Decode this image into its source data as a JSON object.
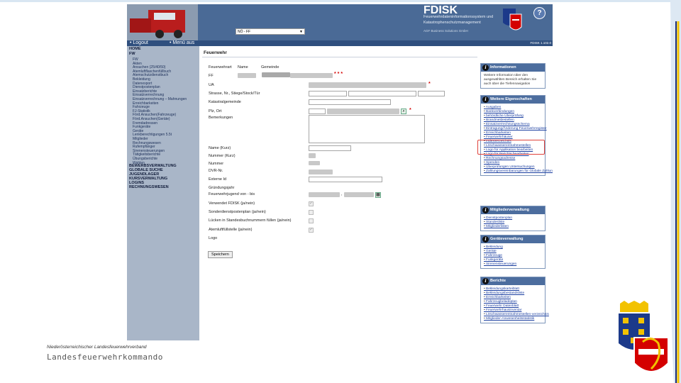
{
  "app": {
    "brand": "FDISK",
    "subtitle": "Feuerwehrdateninformationssystem und Katastrophenschutzmanagement",
    "company": "AGF Business Solutions GmbH",
    "version": "FDISK 1.102.0",
    "ff_select": "NÖ - FF"
  },
  "nav": {
    "logout": "• Logout",
    "menu": "• Menü aus"
  },
  "sidebar": {
    "home": "HOME",
    "fw": "FW",
    "fw_items": [
      "FW",
      "Akten",
      "Ansuchen (25/40/50)",
      "Atemluftflaschenfüllbuch",
      "Atemschutzdienstbuch",
      "Bekleidung",
      "Datenexport",
      "Dienstpostenplan",
      "Einsatzberichte",
      "Einsatzverrechnung",
      "Einsatzverrechnung – Mahnungen",
      "Erreichbarkeiten",
      "Fahrzeuge",
      "FJ-Statistik",
      "Förd.Ansuchen(Fahrzeuge)",
      "Förd.Ansuchen(Geräte)",
      "Fremdadressen",
      "Funkgeräte",
      "Geräte",
      "Lenkberechtigungen 5.5t",
      "Mitglieder",
      "Rechnungswesen",
      "Rufempfänger",
      "Sirenensteuerungen",
      "Tätigkeitsberichte",
      "Übungsberichte",
      "Wahlen"
    ],
    "sections": [
      "BEWERBSVERWALTUNG",
      "GLOBALE SUCHE",
      "JUGENDLAGER",
      "KURSVERWALTUNG",
      "LOGINS",
      "RECHNUNGSWESEN"
    ]
  },
  "main": {
    "title": "Feuerwehr",
    "col_heads": [
      "Feuerwehrart",
      "Name",
      "Gemeinde"
    ],
    "labels": {
      "ff": "FF",
      "ua": "UA",
      "street": "Strasse, Nr., Stiege/Stock/Tür",
      "katastral": "Katastralgemeinde",
      "plz": "Plz, Ort",
      "notes": "Bemerkungen",
      "name_short": "Name (Kurz)",
      "number_short": "Nummer (Kurz)",
      "number": "Nummer",
      "dvr": "DVR-Nr.",
      "external_id": "Externe Id",
      "founding_year": "Gründungsjahr",
      "youth": "Feuerwehrjugend von - bis",
      "uses_fdisk": "Verwendet FDISK (ja/nein)",
      "special_posts": "Sonderdienstpostenplan (ja/nein)",
      "fill_gaps": "Lücken in Standesbuchnummern füllen (ja/nein)",
      "breathing_station": "Atemluftfüllstelle (ja/nein)",
      "logo": "Logo"
    },
    "stars_ff": "* * *",
    "star": "*",
    "youth_sep": ",",
    "save": "Speichern"
  },
  "right": {
    "info": {
      "title": "Informationen",
      "text": "Weitere Information über den ausgewählten Bereich erhalten Sie auch über die Tiefennavigation"
    },
    "props": {
      "title": "Weitere Eigenschaften",
      "links": [
        "Ausgaben",
        "Bankverbindungen",
        "behördliche Überprüfung",
        "Brandmeldestellen",
        "Einsatzverrechnungsschema",
        "Eintragung/Änderung Feuerwehrregister",
        "Erreichbarkeiten",
        "Feuerwehrhäuser",
        "Indexverzeichnis",
        "Löschwasserentnahmestellen",
        "Logo für Applikation bearbeiten",
        "Logo für Berichte bearbeiten",
        "Rechnungsadresse",
        "Spenden",
        "Überprüfungen Untersuchungen",
        "Zahlungsvereinbarungen für Globale Zahlungen"
      ]
    },
    "members": {
      "title": "Mitgliederverwaltung",
      "links": [
        "Dienstpostenplan",
        "Standesliste",
        "Mitgliederlisten"
      ]
    },
    "devices": {
      "title": "Geräteverwaltung",
      "links": [
        "Bekleidung",
        "Geräte",
        "Fahrzeuge",
        "Funkgeräte",
        "Sirenensteuerungen"
      ]
    },
    "reports": {
      "title": "Berichte",
      "links": [
        "Bekleidungskarteiblatt",
        "Bekleidungsbestandsliste",
        "Erreichbarkeiten",
        "Fahrzeugbeladeplan",
        "Feuerwehr Datenblatt",
        "Feuerwehrhausinventar",
        "Löschwasserentnahmestellen-verzeichnis",
        "Mitglieder-Anwesenheitsstatistik"
      ]
    }
  },
  "slide": {
    "footer_small": "Niederösterreichischer Landesfeuerwehrverband",
    "footer_big": "Landesfeuerwehrkommando"
  },
  "colors": {
    "header": "#4a6a96",
    "sidebar": "#a9b6c8",
    "box_head": "#4c6d9e",
    "highlight": "#e0433c",
    "required": "#d40000"
  }
}
